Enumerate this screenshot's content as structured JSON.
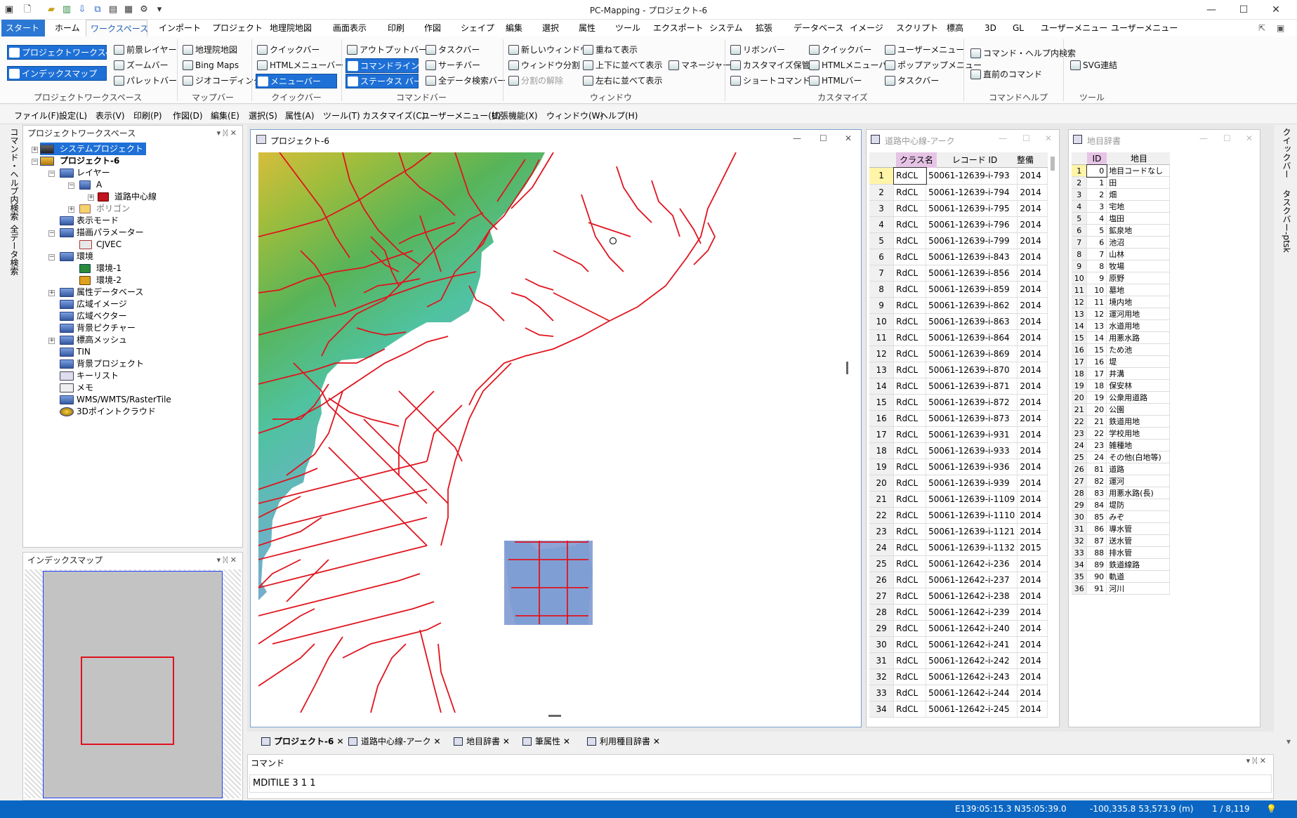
{
  "window": {
    "title": "PC-Mapping - プロジェクト-6",
    "btn_min": "—",
    "btn_max": "☐",
    "btn_close": "✕"
  },
  "ribbon_tabs": [
    "スタート",
    "ホーム",
    "ワークスペース",
    "インポート",
    "プロジェクト",
    "地理院地図",
    "画面表示",
    "印刷",
    "作図",
    "シェイプ",
    "編集",
    "選択",
    "属性",
    "ツール",
    "エクスポート",
    "システム",
    "拡張",
    "データベース",
    "イメージ",
    "スクリプト",
    "標高",
    "3D",
    "GL",
    "ユーザーメニュー",
    "ユーザーメニュー"
  ],
  "ribbon": {
    "ws": {
      "b1": "プロジェクトワークスペース",
      "b2": "インデックスマップ",
      "group": "プロジェクトワークスペース"
    },
    "bg": {
      "b1": "前景レイヤー",
      "b2": "ズームバー",
      "b3": "パレットバー"
    },
    "map": {
      "b1": "地理院地図",
      "b2": "Bing Maps",
      "b3": "ジオコーディング",
      "group": "マップバー"
    },
    "quick": {
      "b1": "クイックバー",
      "b2": "HTMLメニューバー",
      "b3": "メニューバー",
      "group": "クイックバー"
    },
    "cmd": {
      "b1": "アウトプットバー",
      "b2": "コマンドラインバー",
      "b3": "ステータス バー",
      "b4": "タスクバー",
      "b5": "サーチバー",
      "b6": "全データ検索バー",
      "group": "コマンドバー"
    },
    "win": {
      "b1": "新しいウィンドウ",
      "b2": "ウィンドウ分割",
      "b3": "分割の解除",
      "b4": "重ねて表示",
      "b5": "上下に並べて表示",
      "b6": "左右に並べて表示",
      "b7": "マネージャー",
      "group": "ウィンドウ"
    },
    "cust": {
      "b1": "リボンバー",
      "b2": "カスタマイズ保管",
      "b3": "ショートコマンド",
      "b4": "クイックバー",
      "b5": "HTMLメニューバー",
      "b6": "HTMLバー",
      "b7": "ユーザーメニュー",
      "b8": "ポップアップメニュー",
      "b9": "タスクバー",
      "group": "カスタマイズ"
    },
    "help": {
      "b1": "コマンド・ヘルプ内検索",
      "b2": "直前のコマンド",
      "group": "コマンドヘルプ"
    },
    "tool": {
      "b1": "SVG連結",
      "group": "ツール"
    }
  },
  "menubar": [
    "ファイル(F)",
    "設定(L)",
    "表示(V)",
    "印刷(P)",
    "作図(D)",
    "編集(E)",
    "選択(S)",
    "属性(A)",
    "ツール(T)",
    "カスタマイズ(C)",
    "ユーザーメニュー(U)",
    "拡張機能(X)",
    "ウィンドウ(W)",
    "ヘルプ(H)"
  ],
  "left_vtabs": [
    "コマンド・ヘルプ内検索",
    "全データ検索"
  ],
  "right_vtabs": [
    "クイックバー",
    "タスクバー-ptsk"
  ],
  "workspace": {
    "title": "プロジェクトワークスペース",
    "ctl": "▾ ᛞ ✕",
    "nodes": [
      "システムプロジェクト",
      "プロジェクト-6",
      "レイヤー",
      "A",
      "道路中心線",
      "ポリゴン",
      "表示モード",
      "描画パラメーター",
      "CJVEC",
      "環境",
      "環境-1",
      "環境-2",
      "属性データベース",
      "広域イメージ",
      "広域ベクター",
      "背景ピクチャー",
      "標高メッシュ",
      "TIN",
      "背景プロジェクト",
      "キーリスト",
      "メモ",
      "WMS/WMTS/RasterTile",
      "3Dポイントクラウド"
    ]
  },
  "index_map": {
    "title": "インデックスマップ"
  },
  "map_window": {
    "title": "プロジェクト-6",
    "ctl_min": "—",
    "ctl_max": "☐",
    "ctl_close": "✕"
  },
  "colors": {
    "road": "#e0141e",
    "sea": "#ffffff",
    "accent": "#1e70d6",
    "status": "#0a66c2"
  },
  "road_window": {
    "title": "道路中心線-アーク",
    "headers": [
      "クラス名",
      "レコード ID",
      "整備"
    ],
    "rows": [
      [
        "1",
        "RdCL",
        "50061-12639-i-793",
        "2014"
      ],
      [
        "2",
        "RdCL",
        "50061-12639-i-794",
        "2014"
      ],
      [
        "3",
        "RdCL",
        "50061-12639-i-795",
        "2014"
      ],
      [
        "4",
        "RdCL",
        "50061-12639-i-796",
        "2014"
      ],
      [
        "5",
        "RdCL",
        "50061-12639-i-799",
        "2014"
      ],
      [
        "6",
        "RdCL",
        "50061-12639-i-843",
        "2014"
      ],
      [
        "7",
        "RdCL",
        "50061-12639-i-856",
        "2014"
      ],
      [
        "8",
        "RdCL",
        "50061-12639-i-859",
        "2014"
      ],
      [
        "9",
        "RdCL",
        "50061-12639-i-862",
        "2014"
      ],
      [
        "10",
        "RdCL",
        "50061-12639-i-863",
        "2014"
      ],
      [
        "11",
        "RdCL",
        "50061-12639-i-864",
        "2014"
      ],
      [
        "12",
        "RdCL",
        "50061-12639-i-869",
        "2014"
      ],
      [
        "13",
        "RdCL",
        "50061-12639-i-870",
        "2014"
      ],
      [
        "14",
        "RdCL",
        "50061-12639-i-871",
        "2014"
      ],
      [
        "15",
        "RdCL",
        "50061-12639-i-872",
        "2014"
      ],
      [
        "16",
        "RdCL",
        "50061-12639-i-873",
        "2014"
      ],
      [
        "17",
        "RdCL",
        "50061-12639-i-931",
        "2014"
      ],
      [
        "18",
        "RdCL",
        "50061-12639-i-933",
        "2014"
      ],
      [
        "19",
        "RdCL",
        "50061-12639-i-936",
        "2014"
      ],
      [
        "20",
        "RdCL",
        "50061-12639-i-939",
        "2014"
      ],
      [
        "21",
        "RdCL",
        "50061-12639-i-1109",
        "2014"
      ],
      [
        "22",
        "RdCL",
        "50061-12639-i-1110",
        "2014"
      ],
      [
        "23",
        "RdCL",
        "50061-12639-i-1121",
        "2014"
      ],
      [
        "24",
        "RdCL",
        "50061-12639-i-1132",
        "2015"
      ],
      [
        "25",
        "RdCL",
        "50061-12642-i-236",
        "2014"
      ],
      [
        "26",
        "RdCL",
        "50061-12642-i-237",
        "2014"
      ],
      [
        "27",
        "RdCL",
        "50061-12642-i-238",
        "2014"
      ],
      [
        "28",
        "RdCL",
        "50061-12642-i-239",
        "2014"
      ],
      [
        "29",
        "RdCL",
        "50061-12642-i-240",
        "2014"
      ],
      [
        "30",
        "RdCL",
        "50061-12642-i-241",
        "2014"
      ],
      [
        "31",
        "RdCL",
        "50061-12642-i-242",
        "2014"
      ],
      [
        "32",
        "RdCL",
        "50061-12642-i-243",
        "2014"
      ],
      [
        "33",
        "RdCL",
        "50061-12642-i-244",
        "2014"
      ],
      [
        "34",
        "RdCL",
        "50061-12642-i-245",
        "2014"
      ]
    ]
  },
  "chimoku_window": {
    "title": "地目辞書",
    "headers": [
      "ID",
      "地目"
    ],
    "rows": [
      [
        "1",
        "0",
        "地目コードなし"
      ],
      [
        "2",
        "1",
        "田"
      ],
      [
        "3",
        "2",
        "畑"
      ],
      [
        "4",
        "3",
        "宅地"
      ],
      [
        "5",
        "4",
        "塩田"
      ],
      [
        "6",
        "5",
        "鉱泉地"
      ],
      [
        "7",
        "6",
        "池沼"
      ],
      [
        "8",
        "7",
        "山林"
      ],
      [
        "9",
        "8",
        "牧場"
      ],
      [
        "10",
        "9",
        "原野"
      ],
      [
        "11",
        "10",
        "墓地"
      ],
      [
        "12",
        "11",
        "境内地"
      ],
      [
        "13",
        "12",
        "運河用地"
      ],
      [
        "14",
        "13",
        "水道用地"
      ],
      [
        "15",
        "14",
        "用悪水路"
      ],
      [
        "16",
        "15",
        "ため池"
      ],
      [
        "17",
        "16",
        "堤"
      ],
      [
        "18",
        "17",
        "井溝"
      ],
      [
        "19",
        "18",
        "保安林"
      ],
      [
        "20",
        "19",
        "公衆用道路"
      ],
      [
        "21",
        "20",
        "公園"
      ],
      [
        "22",
        "21",
        "鉄道用地"
      ],
      [
        "23",
        "22",
        "学校用地"
      ],
      [
        "24",
        "23",
        "雑種地"
      ],
      [
        "25",
        "24",
        "その他(白地等)"
      ],
      [
        "26",
        "81",
        "道路"
      ],
      [
        "27",
        "82",
        "運河"
      ],
      [
        "28",
        "83",
        "用悪水路(長)"
      ],
      [
        "29",
        "84",
        "堤防"
      ],
      [
        "30",
        "85",
        "みぞ"
      ],
      [
        "31",
        "86",
        "導水管"
      ],
      [
        "32",
        "87",
        "送水管"
      ],
      [
        "33",
        "88",
        "排水管"
      ],
      [
        "34",
        "89",
        "鉄道線路"
      ],
      [
        "35",
        "90",
        "軌道"
      ],
      [
        "36",
        "91",
        "河川"
      ]
    ]
  },
  "doc_tabs": [
    "プロジェクト-6",
    "道路中心線-アーク",
    "地目辞書",
    "筆属性",
    "利用種目辞書"
  ],
  "command": {
    "title": "コマンド",
    "value": "MDITILE 3 1 1"
  },
  "status": {
    "lonlat": "E139:05:15.3 N35:05:39.0",
    "xy": "-100,335.8 53,573.9 (m)",
    "scale": "1 / 8,119"
  }
}
